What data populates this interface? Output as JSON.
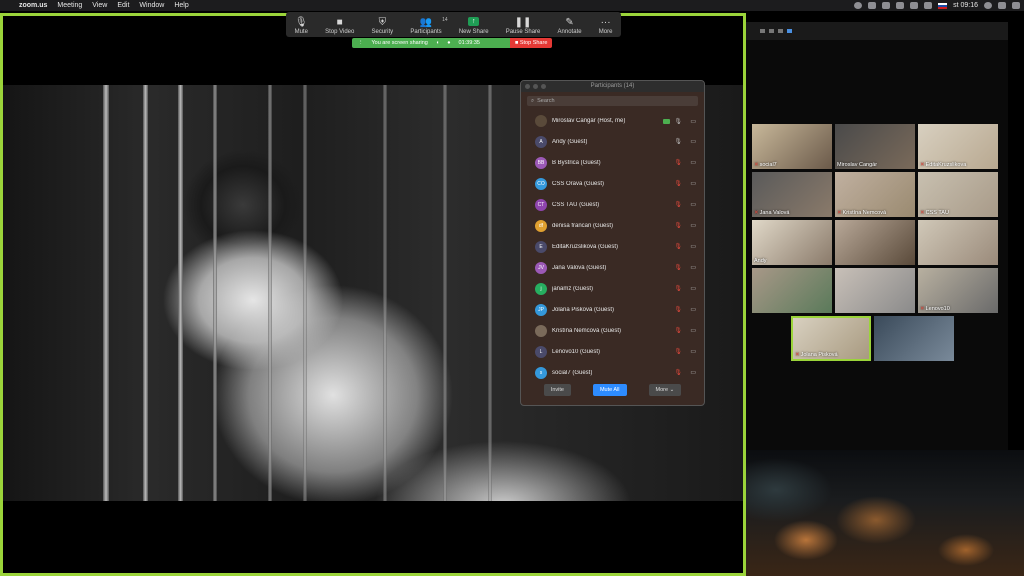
{
  "menubar": {
    "apple": "",
    "items": [
      "zoom.us",
      "Meeting",
      "View",
      "Edit",
      "Window",
      "Help"
    ],
    "clock": "st 09:16"
  },
  "toolbar": {
    "mute": "Mute",
    "stop_video": "Stop Video",
    "security": "Security",
    "participants": "Participants",
    "participants_count": "14",
    "new_share": "New Share",
    "pause_share": "Pause Share",
    "annotate": "Annotate",
    "more": "More"
  },
  "sharebar": {
    "status": "You are screen sharing",
    "timer": "01:39:35",
    "stop": "Stop Share"
  },
  "panel": {
    "title": "Participants (14)",
    "search_placeholder": "Search",
    "invite": "Invite",
    "mute_all": "Mute All",
    "more": "More",
    "participants": [
      {
        "initials": "",
        "name": "Miroslav Cangár (Host, me)",
        "color": "#5a4a3a",
        "mic": "🎙",
        "cam": "▭"
      },
      {
        "initials": "A",
        "name": "Andy (Guest)",
        "color": "#4a4a6a",
        "mic": "🎙",
        "cam": "▭"
      },
      {
        "initials": "BB",
        "name": "B Bystrica (Guest)",
        "color": "#9b59b6",
        "mic": "🎙",
        "cam": "▭"
      },
      {
        "initials": "CO",
        "name": "CSS Orava (Guest)",
        "color": "#3498db",
        "mic": "🎙",
        "cam": "▭"
      },
      {
        "initials": "CT",
        "name": "CSS TAU (Guest)",
        "color": "#8e44ad",
        "mic": "🎙",
        "cam": "▭"
      },
      {
        "initials": "df",
        "name": "denisa francan (Guest)",
        "color": "#e0a030",
        "mic": "🎙",
        "cam": "▭"
      },
      {
        "initials": "E",
        "name": "EditaKruzslikova (Guest)",
        "color": "#4a4a6a",
        "mic": "🎙",
        "cam": "▭"
      },
      {
        "initials": "JV",
        "name": "Jana Valová (Guest)",
        "color": "#9b59b6",
        "mic": "🎙",
        "cam": "▭"
      },
      {
        "initials": "j",
        "name": "janamz (Guest)",
        "color": "#27ae60",
        "mic": "🎙",
        "cam": "▭"
      },
      {
        "initials": "JP",
        "name": "Jolana Pisková (Guest)",
        "color": "#3498db",
        "mic": "🎙",
        "cam": "▭"
      },
      {
        "initials": "",
        "name": "Kristína Nemcová (Guest)",
        "color": "#7a6a5a",
        "mic": "🎙",
        "cam": "▭"
      },
      {
        "initials": "L",
        "name": "Lenovo10 (Guest)",
        "color": "#4a4a6a",
        "mic": "🎙",
        "cam": "▭"
      },
      {
        "initials": "s",
        "name": "social7 (Guest)",
        "color": "#3498db",
        "mic": "🎙",
        "cam": "▭"
      }
    ]
  },
  "gallery": {
    "tiles": [
      {
        "name": "social7",
        "muted": true,
        "active": false
      },
      {
        "name": "Miroslav Cangár",
        "muted": false,
        "active": false
      },
      {
        "name": "EditaKruzslikova",
        "muted": true,
        "active": false
      },
      {
        "name": "Jana Valová",
        "muted": true,
        "active": false
      },
      {
        "name": "Kristína Nemcová",
        "muted": true,
        "active": false
      },
      {
        "name": "CSS TAU",
        "muted": true,
        "active": false
      },
      {
        "name": "Andy",
        "muted": false,
        "active": false
      },
      {
        "name": "",
        "muted": false,
        "active": false
      },
      {
        "name": "",
        "muted": false,
        "active": false
      },
      {
        "name": "",
        "muted": false,
        "active": false
      },
      {
        "name": "",
        "muted": false,
        "active": false
      },
      {
        "name": "Lenovo10",
        "muted": true,
        "active": false
      },
      {
        "name": "Jolana Pisková",
        "muted": true,
        "active": true
      },
      {
        "name": "",
        "muted": false,
        "active": false
      }
    ]
  },
  "colors": {
    "share_border": "#9bd43a",
    "sharing_bar": "#4caf50",
    "stop_share": "#e53935",
    "primary_button": "#2d8cff",
    "muted_icon": "#e64a3d"
  }
}
